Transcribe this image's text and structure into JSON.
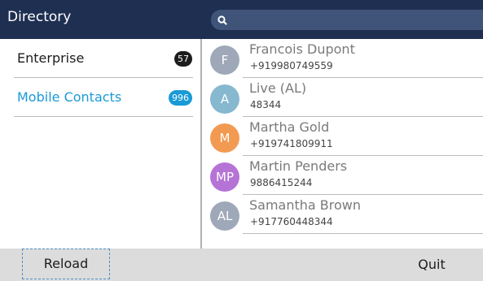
{
  "header": {
    "title": "Directory",
    "search_icon": "search-icon"
  },
  "colors": {
    "header_bg": "#1e2f52",
    "search_bg": "#3f5478",
    "accent": "#1a9ad6",
    "footer_bg": "#dcdcdc"
  },
  "directories": [
    {
      "label": "Enterprise",
      "count": "57",
      "active": false
    },
    {
      "label": "Mobile Contacts",
      "count": "996",
      "active": true
    }
  ],
  "contacts": [
    {
      "initials": "F",
      "name": "Francois Dupont",
      "number": "+919980749559",
      "avatar_color": "#9ea8b8"
    },
    {
      "initials": "A",
      "name": "Live (AL)",
      "number": "48344",
      "avatar_color": "#86b8cf"
    },
    {
      "initials": "M",
      "name": "Martha Gold",
      "number": "+919741809911",
      "avatar_color": "#f39a52"
    },
    {
      "initials": "MP",
      "name": "Martin Penders",
      "number": "9886415244",
      "avatar_color": "#b573d6"
    },
    {
      "initials": "AL",
      "name": "Samantha Brown",
      "number": "+917760448344",
      "avatar_color": "#9ea8b8"
    }
  ],
  "footer": {
    "reload_label": "Reload",
    "quit_label": "Quit"
  }
}
